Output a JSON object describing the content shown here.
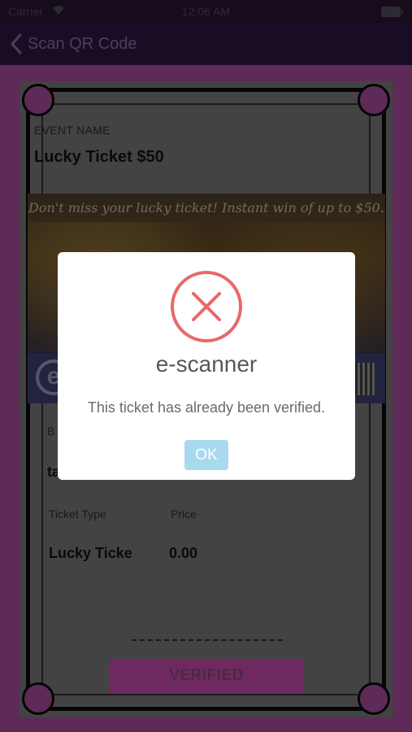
{
  "status_bar": {
    "carrier": "Carrier",
    "time": "12:06 AM"
  },
  "nav": {
    "back_label": "Scan QR Code"
  },
  "ticket": {
    "event_label": "EVENT NAME",
    "event_name": "Lucky Ticket $50",
    "banner_tagline": "Don't miss your lucky ticket! Instant win of up to $50.",
    "booking_label": "B",
    "booking_value": "ta",
    "ticket_type_label": "Ticket Type",
    "price_label": "Price",
    "ticket_type_value": "Lucky Ticke",
    "price_value": "0.00",
    "status_button": "VERIFIED"
  },
  "alert": {
    "icon": "error-x-icon",
    "title": "e-scanner",
    "message": "This ticket has already been verified.",
    "ok_label": "OK"
  },
  "colors": {
    "nav_bg": "#1a0c24",
    "page_bg": "#5e2a57",
    "alert_error": "#e8696b",
    "ok_button": "#a9d9ef"
  }
}
